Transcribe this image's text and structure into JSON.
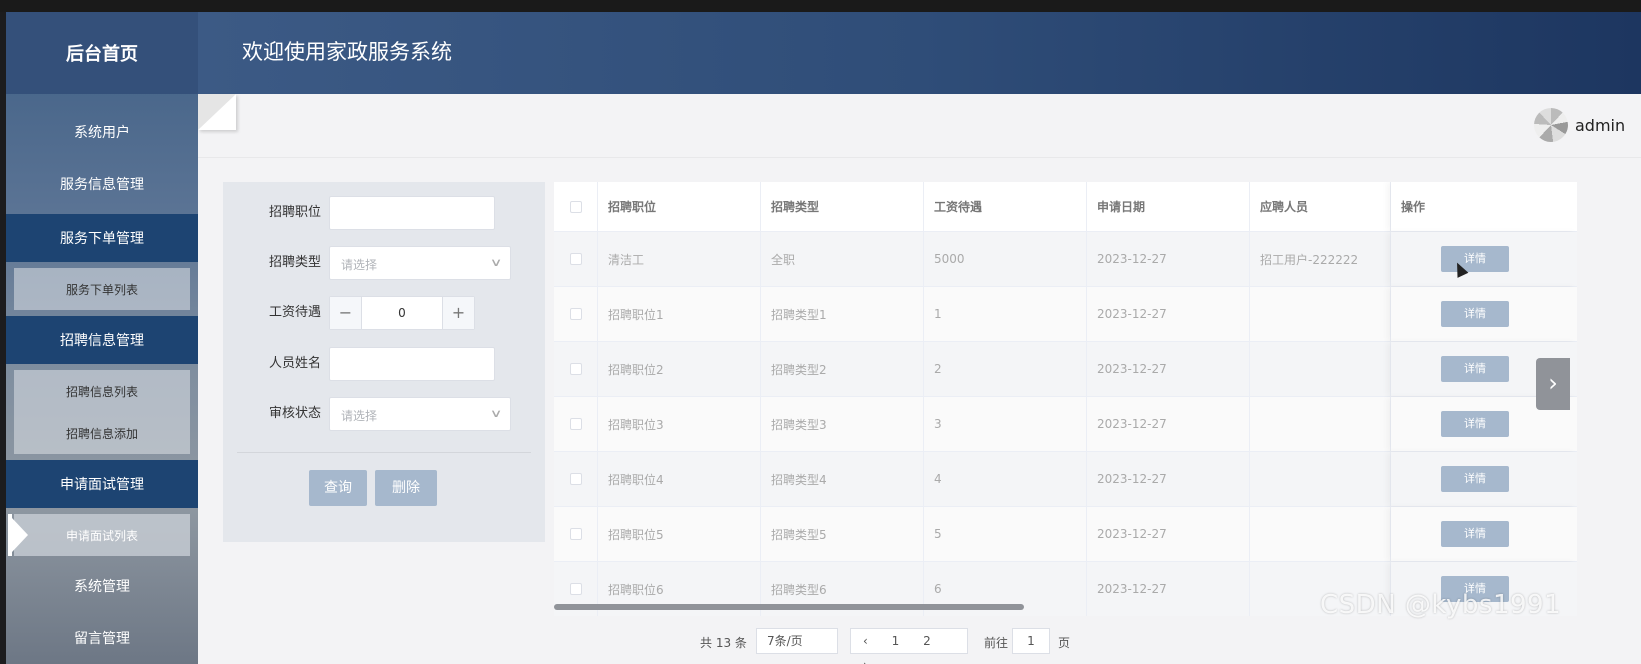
{
  "sidebar": {
    "home": "后台首页",
    "items": [
      {
        "label": "系统用户"
      },
      {
        "label": "服务信息管理"
      },
      {
        "label": "服务下单管理"
      },
      {
        "label": "招聘信息管理"
      },
      {
        "label": "申请面试管理"
      },
      {
        "label": "系统管理"
      },
      {
        "label": "留言管理"
      }
    ],
    "sub_order": [
      "服务下单列表"
    ],
    "sub_recruit": [
      "招聘信息列表",
      "招聘信息添加"
    ],
    "sub_interview": [
      "申请面试列表"
    ]
  },
  "header": {
    "title": "欢迎使用家政服务系统"
  },
  "user": {
    "name": "admin"
  },
  "search": {
    "position_label": "招聘职位",
    "type_label": "招聘类型",
    "type_placeholder": "请选择",
    "salary_label": "工资待遇",
    "salary_value": "0",
    "name_label": "人员姓名",
    "status_label": "审核状态",
    "status_placeholder": "请选择",
    "query_button": "查询",
    "delete_button": "删除"
  },
  "table": {
    "columns": [
      "招聘职位",
      "招聘类型",
      "工资待遇",
      "申请日期",
      "应聘人员",
      "操作"
    ],
    "detail_label": "详情",
    "rows": [
      [
        "清洁工",
        "全职",
        "5000",
        "2023-12-27",
        "招工用户-222222"
      ],
      [
        "招聘职位1",
        "招聘类型1",
        "1",
        "2023-12-27",
        ""
      ],
      [
        "招聘职位2",
        "招聘类型2",
        "2",
        "2023-12-27",
        ""
      ],
      [
        "招聘职位3",
        "招聘类型3",
        "3",
        "2023-12-27",
        ""
      ],
      [
        "招聘职位4",
        "招聘类型4",
        "4",
        "2023-12-27",
        ""
      ],
      [
        "招聘职位5",
        "招聘类型5",
        "5",
        "2023-12-27",
        ""
      ],
      [
        "招聘职位6",
        "招聘类型6",
        "6",
        "2023-12-27",
        ""
      ]
    ]
  },
  "pagination": {
    "total": "共 13 条",
    "page_size": "7条/页",
    "pages": "‹ 1 2 ›",
    "goto": "前往",
    "jump_value": "1",
    "unit": "页"
  },
  "watermark": "CSDN @kybs1991"
}
